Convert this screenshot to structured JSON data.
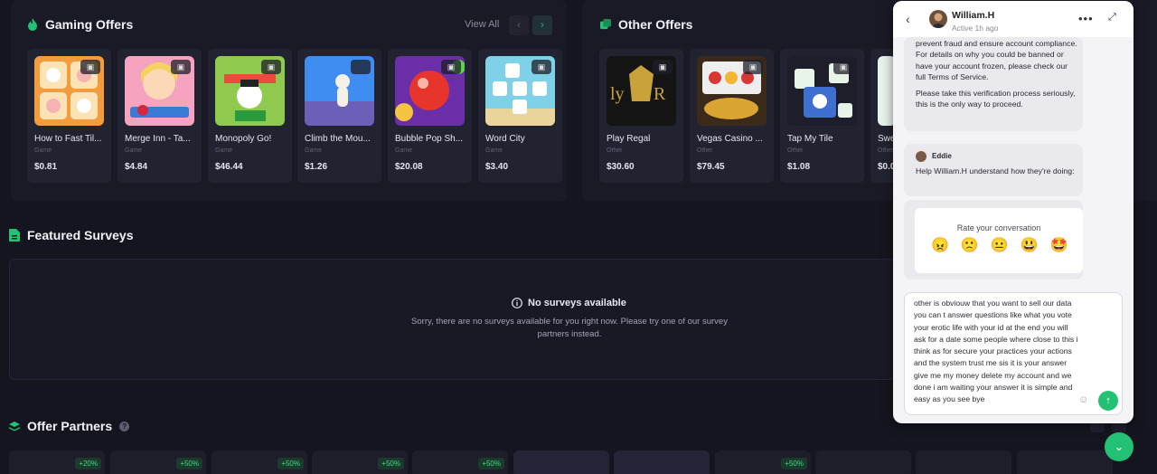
{
  "gaming": {
    "title": "Gaming Offers",
    "view_all": "View All",
    "prev_icon": "chevron-left-icon",
    "next_icon": "chevron-right-icon",
    "cards": [
      {
        "name": "How to Fast Til...",
        "category": "Game",
        "price": "$0.81",
        "os": "android"
      },
      {
        "name": "Merge Inn - Ta...",
        "category": "Game",
        "price": "$4.84",
        "os": "android"
      },
      {
        "name": "Monopoly Go!",
        "category": "Game",
        "price": "$46.44",
        "os": "android"
      },
      {
        "name": "Climb the Mou...",
        "category": "Game",
        "price": "$1.26",
        "os": "apple"
      },
      {
        "name": "Bubble Pop Sh...",
        "category": "Game",
        "price": "$20.08",
        "os": "android"
      },
      {
        "name": "Word City",
        "category": "Game",
        "price": "$3.40",
        "os": "android"
      }
    ]
  },
  "other": {
    "title": "Other Offers",
    "cards": [
      {
        "name": "Play Regal",
        "category": "Other",
        "price": "$30.60",
        "os": "android"
      },
      {
        "name": "Vegas Casino ...",
        "category": "Other",
        "price": "$79.45",
        "os": "android"
      },
      {
        "name": "Tap My Tile",
        "category": "Other",
        "price": "$1.08",
        "os": "android"
      },
      {
        "name": "Swe",
        "category": "Other",
        "price": "$0.0",
        "os": "android"
      }
    ]
  },
  "surveys": {
    "title": "Featured Surveys",
    "empty_title": "No surveys available",
    "empty_text": "Sorry, there are no surveys available for you right now. Please try one of our survey partners instead."
  },
  "partners": {
    "title": "Offer Partners",
    "badges": [
      "+20%",
      "+50%",
      "+50%",
      "+50%",
      "+50%",
      "",
      "",
      "+50%"
    ]
  },
  "chat": {
    "name": "William.H",
    "status": "Active 1h ago",
    "bubble1": {
      "p1": "prevent fraud and ensure account compliance.",
      "p2": "For details on why you could be banned or have your account frozen, please check our full Terms of Service.",
      "p3": "Please take this verification process seriously, this is the only way to proceed."
    },
    "bubble2": {
      "sender": "Eddie",
      "text": "Help William.H understand how they're doing:"
    },
    "rating": {
      "title": "Rate your conversation",
      "emojis": [
        "😠",
        "🙁",
        "😐",
        "😃",
        "🤩"
      ]
    },
    "composer_text": "other is obviouw that you want to sell our data you can t answer questions like what you vote your erotic life with your id at the end you will ask for a date some people where close to this i think as for secure your practices your actions and the system trust me sis it is your answer give me my money delete my account and we done i am waiting your answer it is simple and easy as you see bye"
  },
  "colors": {
    "accent": "#22c174",
    "background": "#15151f",
    "card": "#222331"
  }
}
